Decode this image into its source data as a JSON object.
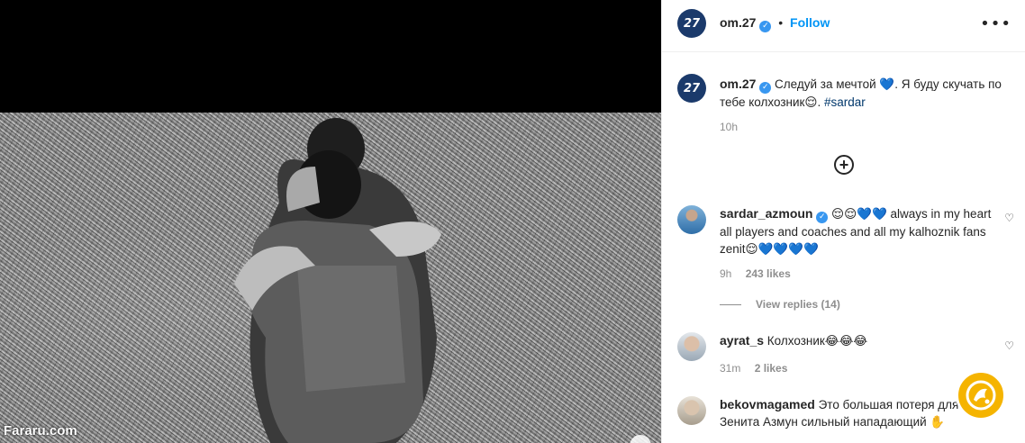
{
  "post": {
    "username": "om.27",
    "avatar_text": "27",
    "follow_label": "Follow",
    "more_label": "•••",
    "caption_main": "Следуй за мечтой 💙. Я буду скучать по тебе колхозник😌. ",
    "caption_tag": "#sardar",
    "caption_time": "10h"
  },
  "media": {
    "watermark": "Fararu.com",
    "next_icon": "chevron-right-icon"
  },
  "add_comment_icon": "plus-circle-icon",
  "comments": [
    {
      "username": "sardar_azmoun",
      "text": " 😌😌💙💙 always in my heart all players and coaches and all my kalhoznik fans zenit😌💙💙💙💙",
      "time": "9h",
      "likes": "243 likes",
      "view_replies": "View replies (14)"
    },
    {
      "username": "ayrat_s",
      "text": " Колхозник😂😂😂",
      "time": "31m",
      "likes": "2 likes"
    },
    {
      "username": "bekovmagamed",
      "text": " Это большая потеря для Зенита Азмун сильный нападающий ✋"
    }
  ],
  "colors": {
    "accent": "#0095f6",
    "verified": "#3897f0",
    "hashtag": "#00376b",
    "secondary_text": "#8e8e8e",
    "logo_badge": "#f5b400"
  }
}
